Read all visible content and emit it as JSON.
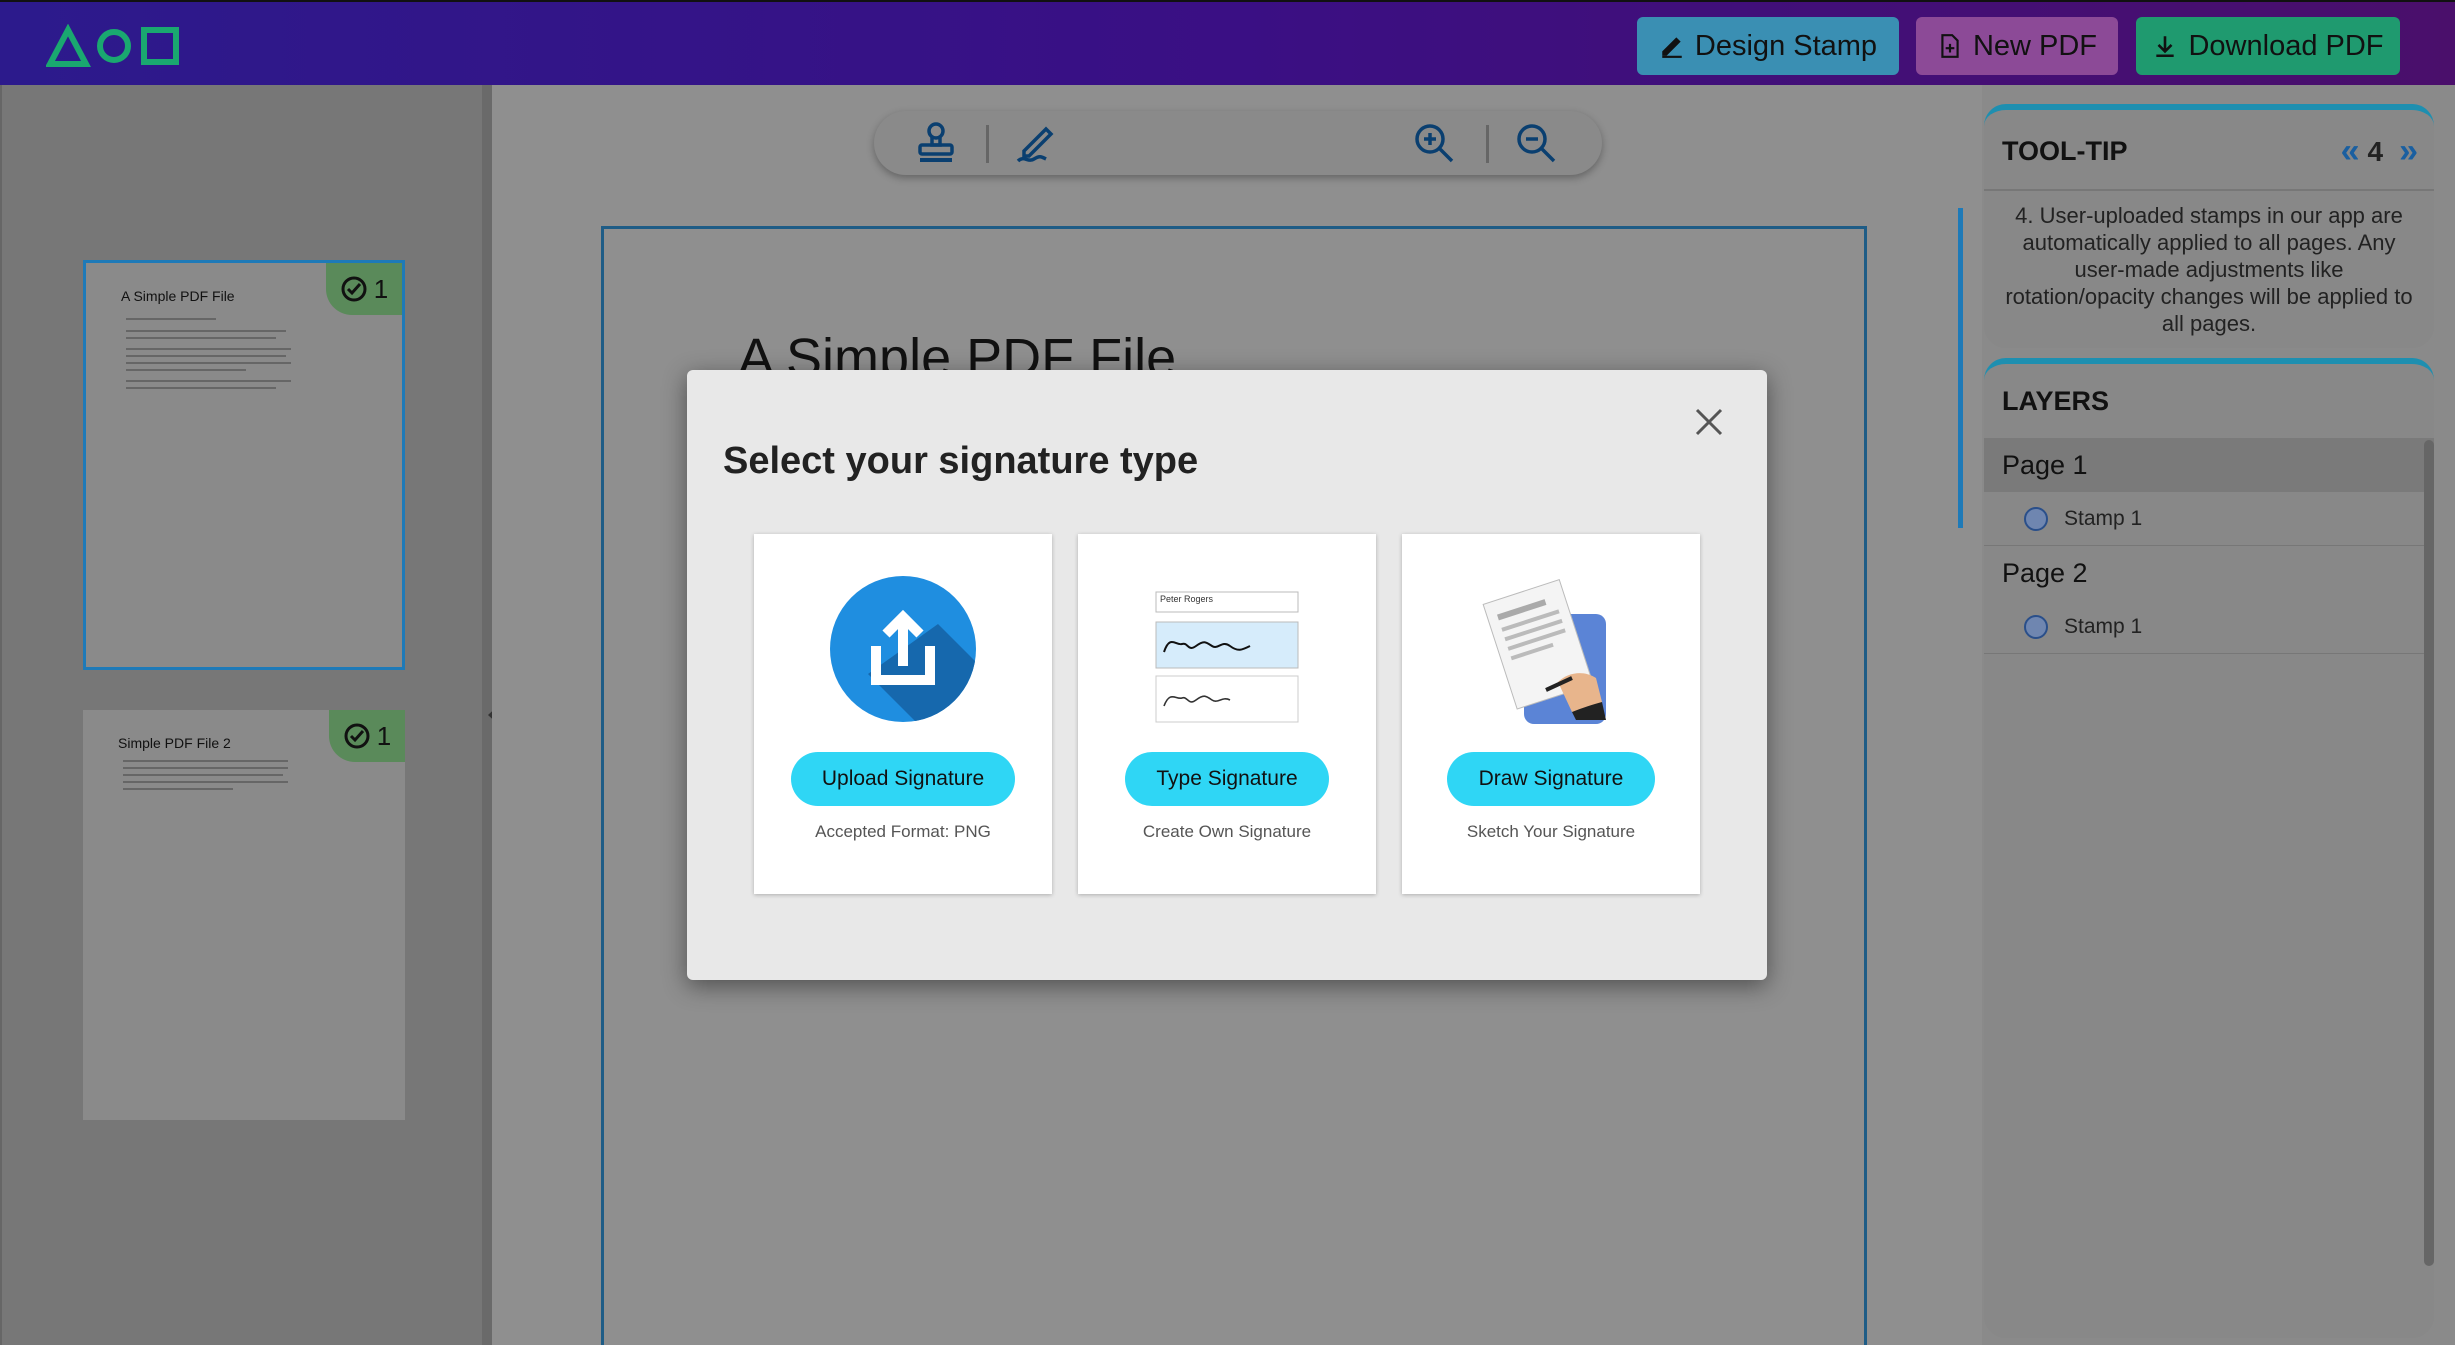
{
  "header": {
    "design_stamp_label": "Design Stamp",
    "new_pdf_label": "New PDF",
    "download_pdf_label": "Download PDF",
    "colors": {
      "design": "#3a8fb3",
      "new": "#8c4a97",
      "download": "#1f9a6f"
    }
  },
  "thumbnails": [
    {
      "title": "A Simple PDF File",
      "badge_count": "1",
      "selected": true
    },
    {
      "title": "Simple PDF File 2",
      "badge_count": "1",
      "selected": false
    }
  ],
  "toolbar": {
    "icons": [
      "stamp-icon",
      "signature-icon",
      "zoom-in-icon",
      "zoom-out-icon"
    ]
  },
  "document": {
    "page_title": "A Simple PDF File"
  },
  "tooltip": {
    "heading": "TOOL-TIP",
    "index": "4",
    "text": "4. User-uploaded stamps in our app are automatically applied to all pages. Any user-made adjustments like rotation/opacity changes will be applied to all pages."
  },
  "layers": {
    "heading": "LAYERS",
    "pages": [
      {
        "label": "Page 1",
        "stamps": [
          "Stamp 1"
        ]
      },
      {
        "label": "Page 2",
        "stamps": [
          "Stamp 1"
        ]
      }
    ]
  },
  "modal": {
    "title": "Select your signature type",
    "options": [
      {
        "button": "Upload Signature",
        "caption": "Accepted Format: PNG",
        "icon": "upload-icon"
      },
      {
        "button": "Type Signature",
        "caption": "Create Own Signature",
        "icon": "typed-signature-icon",
        "sample_name": "Peter Rogers"
      },
      {
        "button": "Draw Signature",
        "caption": "Sketch Your Signature",
        "icon": "hand-drawing-icon"
      }
    ]
  }
}
